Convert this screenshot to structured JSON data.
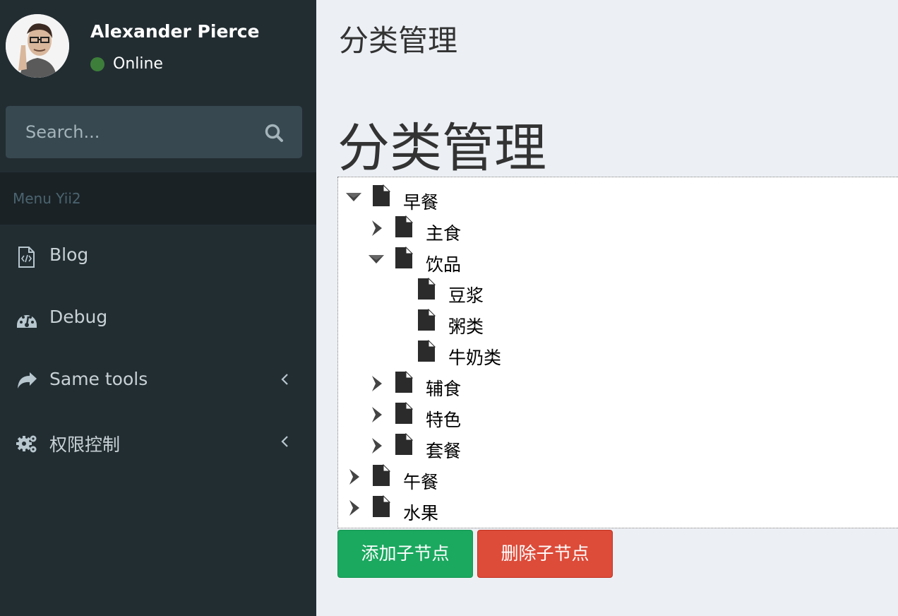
{
  "user": {
    "name": "Alexander Pierce",
    "status": "Online"
  },
  "search": {
    "placeholder": "Search..."
  },
  "menu": {
    "header": "Menu Yii2",
    "items": [
      {
        "label": "Blog",
        "icon": "file-code-icon"
      },
      {
        "label": "Debug",
        "icon": "dashboard-icon"
      },
      {
        "label": "Same tools",
        "icon": "share-icon"
      },
      {
        "label": "权限控制",
        "icon": "gears-icon"
      }
    ]
  },
  "page": {
    "header_title": "分类管理",
    "section_title": "分类管理"
  },
  "tree": {
    "nodes": [
      {
        "label": "早餐",
        "state": "expanded"
      },
      {
        "label": "主食",
        "state": "collapsed"
      },
      {
        "label": "饮品",
        "state": "expanded"
      },
      {
        "label": "豆浆",
        "state": "leaf"
      },
      {
        "label": "粥类",
        "state": "leaf"
      },
      {
        "label": "牛奶类",
        "state": "leaf"
      },
      {
        "label": "辅食",
        "state": "collapsed"
      },
      {
        "label": "特色",
        "state": "collapsed"
      },
      {
        "label": "套餐",
        "state": "collapsed"
      },
      {
        "label": "午餐",
        "state": "collapsed"
      },
      {
        "label": "水果",
        "state": "collapsed"
      }
    ]
  },
  "actions": {
    "add_label": "添加子节点",
    "delete_label": "删除子节点"
  },
  "colors": {
    "sidebar_bg": "#222d32",
    "content_bg": "#ecf0f5",
    "success": "#1ba85f",
    "danger": "#dd4b39",
    "online": "#3d7e3a"
  }
}
